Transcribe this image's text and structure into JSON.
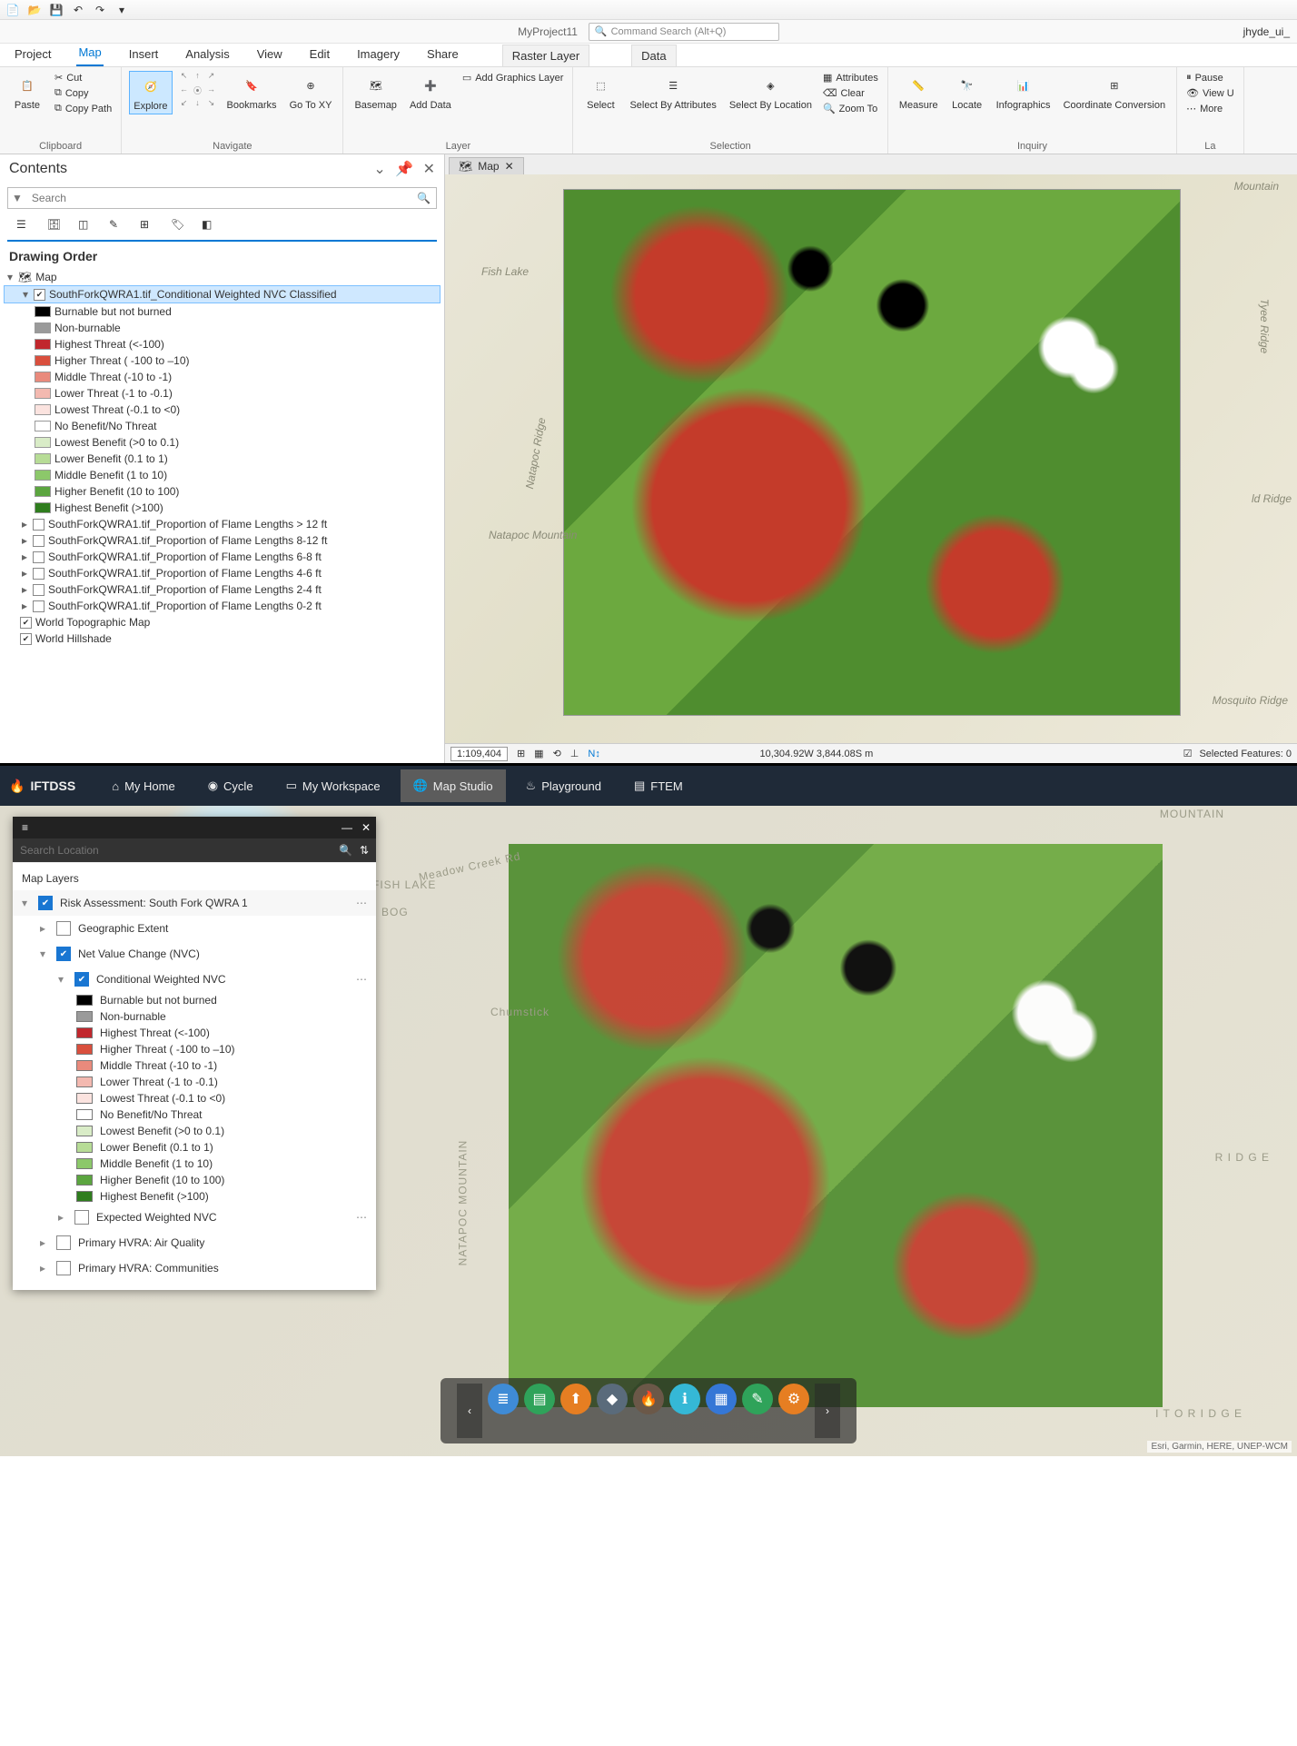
{
  "arcgis": {
    "project_name": "MyProject11",
    "command_search_placeholder": "Command Search (Alt+Q)",
    "user": "jhyde_ui_",
    "ribbon_tabs": [
      "Project",
      "Map",
      "Insert",
      "Analysis",
      "View",
      "Edit",
      "Imagery",
      "Share"
    ],
    "ribbon_ctx_tabs": [
      "Raster Layer",
      "Data"
    ],
    "active_ribbon_tab": "Map",
    "ribbon": {
      "clipboard": {
        "label": "Clipboard",
        "paste": "Paste",
        "cut": "Cut",
        "copy": "Copy",
        "copy_path": "Copy Path"
      },
      "navigate": {
        "label": "Navigate",
        "explore": "Explore",
        "bookmarks": "Bookmarks",
        "go_to_xy": "Go To XY"
      },
      "layer": {
        "label": "Layer",
        "basemap": "Basemap",
        "add_data": "Add Data",
        "add_graphics": "Add Graphics Layer"
      },
      "selection": {
        "label": "Selection",
        "select": "Select",
        "select_by_attr": "Select By Attributes",
        "select_by_loc": "Select By Location",
        "attributes": "Attributes",
        "clear": "Clear",
        "zoom_to": "Zoom To"
      },
      "inquiry": {
        "label": "Inquiry",
        "measure": "Measure",
        "locate": "Locate",
        "infographics": "Infographics",
        "coord": "Coordinate Conversion"
      },
      "labeling": {
        "label": "La",
        "pause": "Pause",
        "view_unplaced": "View U",
        "more": "More"
      }
    },
    "contents": {
      "title": "Contents",
      "search_placeholder": "Search",
      "drawing_order": "Drawing Order",
      "root": "Map",
      "active_layer": "SouthForkQWRA1.tif_Conditional Weighted NVC Classified",
      "legend": [
        {
          "c": "#000000",
          "t": "Burnable but not burned"
        },
        {
          "c": "#9a9a9a",
          "t": "Non-burnable"
        },
        {
          "c": "#c1272d",
          "t": "Highest Threat (<-100)"
        },
        {
          "c": "#d94f3d",
          "t": "Higher Threat ( -100 to –10)"
        },
        {
          "c": "#e98a7c",
          "t": "Middle Threat (-10 to -1)"
        },
        {
          "c": "#f3b9b0",
          "t": "Lower Threat (-1 to -0.1)"
        },
        {
          "c": "#fbe3df",
          "t": "Lowest Threat (-0.1 to <0)"
        },
        {
          "c": "#ffffff",
          "t": "No Benefit/No Threat"
        },
        {
          "c": "#d9ecc7",
          "t": "Lowest Benefit (>0 to 0.1)"
        },
        {
          "c": "#b7dc96",
          "t": "Lower Benefit (0.1 to 1)"
        },
        {
          "c": "#8cc86a",
          "t": "Middle Benefit (1 to 10)"
        },
        {
          "c": "#5ba53f",
          "t": "Higher Benefit (10 to 100)"
        },
        {
          "c": "#2f7d1e",
          "t": "Highest Benefit (>100)"
        }
      ],
      "other_layers": [
        "SouthForkQWRA1.tif_Proportion of Flame Lengths > 12 ft",
        "SouthForkQWRA1.tif_Proportion of Flame Lengths 8-12 ft",
        "SouthForkQWRA1.tif_Proportion of Flame Lengths 6-8 ft",
        "SouthForkQWRA1.tif_Proportion of Flame Lengths 4-6 ft",
        "SouthForkQWRA1.tif_Proportion of Flame Lengths 2-4 ft",
        "SouthForkQWRA1.tif_Proportion of Flame Lengths 0-2 ft"
      ],
      "basemaps": [
        {
          "name": "World Topographic Map",
          "checked": true
        },
        {
          "name": "World Hillshade",
          "checked": true
        }
      ]
    },
    "map_tab": "Map",
    "map_labels": {
      "fish_lake": "Fish Lake",
      "natapoc_ridge": "Natapoc Ridge",
      "natapoc_mtn": "Natapoc Mountain",
      "mountain_ne": "Mountain",
      "tyee": "Tyee Ridge",
      "ld_ridge": "ld Ridge",
      "mosquito": "Mosquito Ridge"
    },
    "status": {
      "scale": "1:109,404",
      "coords": "10,304.92W 3,844.08S m",
      "selected": "Selected Features: 0"
    }
  },
  "iftdss": {
    "brand": "IFTDSS",
    "tabs": [
      {
        "label": "My Home",
        "icon": "home"
      },
      {
        "label": "Cycle",
        "icon": "cycle"
      },
      {
        "label": "My Workspace",
        "icon": "folder"
      },
      {
        "label": "Map Studio",
        "icon": "globe",
        "active": true
      },
      {
        "label": "Playground",
        "icon": "flame"
      },
      {
        "label": "FTEM",
        "icon": "doc"
      }
    ],
    "panel": {
      "search_placeholder": "Search Location",
      "section_label": "Map Layers",
      "risk_layer": "Risk Assessment: South Fork QWRA 1",
      "geo_extent": "Geographic Extent",
      "nvc": "Net Value Change (NVC)",
      "cwnvc": "Conditional Weighted NVC",
      "legend": [
        {
          "c": "#000000",
          "t": "Burnable but not burned"
        },
        {
          "c": "#9a9a9a",
          "t": "Non-burnable"
        },
        {
          "c": "#c1272d",
          "t": "Highest Threat (<-100)"
        },
        {
          "c": "#d94f3d",
          "t": "Higher Threat ( -100 to –10)"
        },
        {
          "c": "#e98a7c",
          "t": "Middle Threat (-10 to -1)"
        },
        {
          "c": "#f3b9b0",
          "t": "Lower Threat (-1 to -0.1)"
        },
        {
          "c": "#fbe3df",
          "t": "Lowest Threat (-0.1 to <0)"
        },
        {
          "c": "#ffffff",
          "t": "No Benefit/No Threat"
        },
        {
          "c": "#d9ecc7",
          "t": "Lowest Benefit (>0 to 0.1)"
        },
        {
          "c": "#b7dc96",
          "t": "Lower Benefit (0.1 to 1)"
        },
        {
          "c": "#8cc86a",
          "t": "Middle Benefit (1 to 10)"
        },
        {
          "c": "#5ba53f",
          "t": "Higher Benefit (10 to 100)"
        },
        {
          "c": "#2f7d1e",
          "t": "Highest Benefit (>100)"
        }
      ],
      "expected": "Expected Weighted NVC",
      "hvra_air": "Primary HVRA: Air Quality",
      "hvra_comm": "Primary HVRA: Communities"
    },
    "labels": {
      "mountain": "MOUNTAIN",
      "fish_lake": "FISH LAKE",
      "bog": "BOG",
      "chumstick": "Chumstick",
      "natapoc": "NATAPOC MOUNTAIN",
      "ridge": "R I D G E",
      "ito_ridge": "I T O   R I D G E",
      "meadow": "Meadow Creek Rd"
    },
    "credits": "Esri, Garmin, HERE, UNEP-WCM",
    "tools": [
      {
        "name": "layers",
        "color": "#3f8bd6"
      },
      {
        "name": "base",
        "color": "#2fa35a"
      },
      {
        "name": "upload",
        "color": "#e67e22"
      },
      {
        "name": "identify",
        "color": "#5a6b7b"
      },
      {
        "name": "fire",
        "color": "#6b5848"
      },
      {
        "name": "info",
        "color": "#35b8d6"
      },
      {
        "name": "apps",
        "color": "#3577d6"
      },
      {
        "name": "edit",
        "color": "#2fa35a"
      },
      {
        "name": "settings",
        "color": "#e67e22"
      }
    ]
  }
}
